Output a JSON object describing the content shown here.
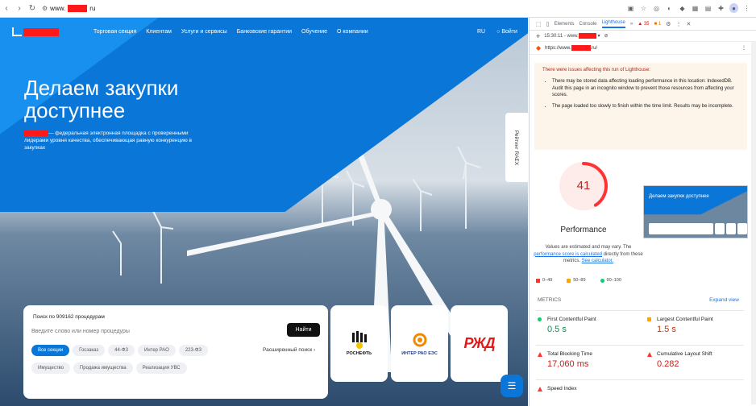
{
  "browser": {
    "url": "www.",
    "url_suffix": "ru"
  },
  "nav": {
    "items": [
      "Торговая секция",
      "Клиентам",
      "Услуги и сервисы",
      "Банковские гарантии",
      "Обучение",
      "О компании"
    ],
    "lang": "RU",
    "login": "Войти"
  },
  "hero": {
    "title": "Делаем закупки доступнее",
    "lead": "— федеральная электронная площадка с проверенными лидерами уровня качества, обеспечивающая равную конкуренцию в закупках",
    "side_tab": "Рейтинг RAEX"
  },
  "search": {
    "label": "Поиск по 909162 процедурам",
    "placeholder": "Введите слово или номер процедуры",
    "button": "Найти",
    "chips": [
      "Все секции",
      "Госзаказ",
      "44-ФЗ",
      "Интер РАО",
      "223-ФЗ",
      "Имущество",
      "Продажа имущества",
      "Реализация УВС"
    ],
    "ext": "Расширенный поиск"
  },
  "partners": [
    {
      "name": "РОСНЕФТЬ"
    },
    {
      "name": "ИНТЕР РАО ЕЭС"
    },
    {
      "name": "РЖД"
    }
  ],
  "devtools": {
    "tabs": [
      "Elements",
      "Console",
      "Lighthouse"
    ],
    "badges": {
      "errors": "35",
      "warnings": "1"
    },
    "report_time": "15:30:11 - www.",
    "report_url": "https://www.",
    "report_url_end": ".ru/",
    "warning_title": "There were issues affecting this run of Lighthouse:",
    "warnings": [
      "There may be stored data affecting loading performance in this location: IndexedDB. Audit this page in an incognito window to prevent those resources from affecting your scores.",
      "The page loaded too slowly to finish within the time limit. Results may be incomplete."
    ],
    "score": "41",
    "score_fraction": 0.41,
    "category": "Performance",
    "note_pre": "Values are estimated and may vary. The ",
    "note_link": "performance score is calculated",
    "note_mid": " directly from these metrics. ",
    "note_link2": "See calculator.",
    "legend": [
      "0–49",
      "50–89",
      "90–100"
    ],
    "metrics_title": "METRICS",
    "expand": "Expand view",
    "metrics": [
      {
        "label": "First Contentful Paint",
        "value": "0.5 s",
        "status": "green"
      },
      {
        "label": "Largest Contentful Paint",
        "value": "1.5 s",
        "status": "orange"
      },
      {
        "label": "Total Blocking Time",
        "value": "17,060 ms",
        "status": "red"
      },
      {
        "label": "Cumulative Layout Shift",
        "value": "0.282",
        "status": "red"
      },
      {
        "label": "Speed Index",
        "value": "",
        "status": "red"
      }
    ],
    "thumb_title": "Делаем закупки доступнее"
  },
  "colors": {
    "brand_blue": "#0a77d8",
    "score_red": "#f33",
    "pass": "#0cce6b",
    "avg": "#ffa400"
  }
}
